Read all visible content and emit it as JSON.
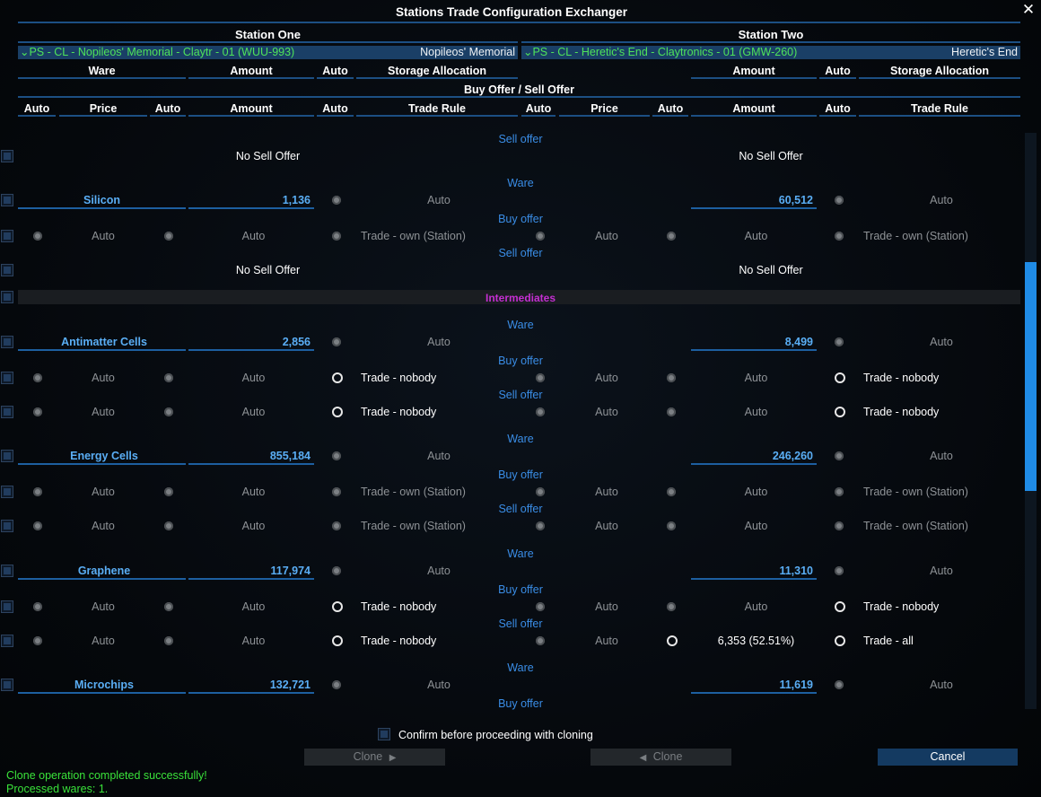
{
  "window": {
    "title": "Stations Trade Configuration Exchanger",
    "close_symbol": "✕"
  },
  "stations": {
    "one": {
      "heading": "Station One",
      "selector": "⌄PS - CL - Nopileos' Memorial - Claytr - 01 (WUU-993)",
      "name": "Nopileos' Memorial"
    },
    "two": {
      "heading": "Station Two",
      "selector": "⌄PS - CL - Heretic's End - Claytronics - 01 (GMW-260)",
      "name": "Heretic's End"
    }
  },
  "columns": {
    "ware": "Ware",
    "amount": "Amount",
    "auto": "Auto",
    "storage": "Storage Allocation",
    "buy_sell": "Buy Offer / Sell Offer",
    "price": "Price",
    "trade_rule": "Trade Rule"
  },
  "labels": {
    "sell_offer": "Sell offer",
    "buy_offer": "Buy offer",
    "ware": "Ware",
    "no_sell_offer": "No Sell Offer",
    "auto": "Auto",
    "trade_own": "Trade - own (Station)",
    "trade_nobody": "Trade - nobody",
    "trade_all": "Trade - all"
  },
  "category": "Intermediates",
  "wares": {
    "silicon": {
      "name": "Silicon",
      "amount_one": "1,136",
      "amount_two": "60,512"
    },
    "antimatter": {
      "name": "Antimatter Cells",
      "amount_one": "2,856",
      "amount_two": "8,499"
    },
    "energy": {
      "name": "Energy Cells",
      "amount_one": "855,184",
      "amount_two": "246,260"
    },
    "graphene": {
      "name": "Graphene",
      "amount_one": "117,974",
      "amount_two": "11,310",
      "sell_amount_two": "6,353 (52.51%)"
    },
    "microchips": {
      "name": "Microchips",
      "amount_one": "132,721",
      "amount_two": "11,619"
    }
  },
  "footer": {
    "confirm": "Confirm before proceeding with cloning",
    "clone_right": "Clone",
    "clone_left": "Clone",
    "cancel": "Cancel",
    "status1": "Clone operation completed successfully!",
    "status2": "Processed wares: 1."
  },
  "icons": {
    "close": "close-icon",
    "radio": "radio-icon",
    "arrow_right": "▶",
    "arrow_left": "◀"
  }
}
